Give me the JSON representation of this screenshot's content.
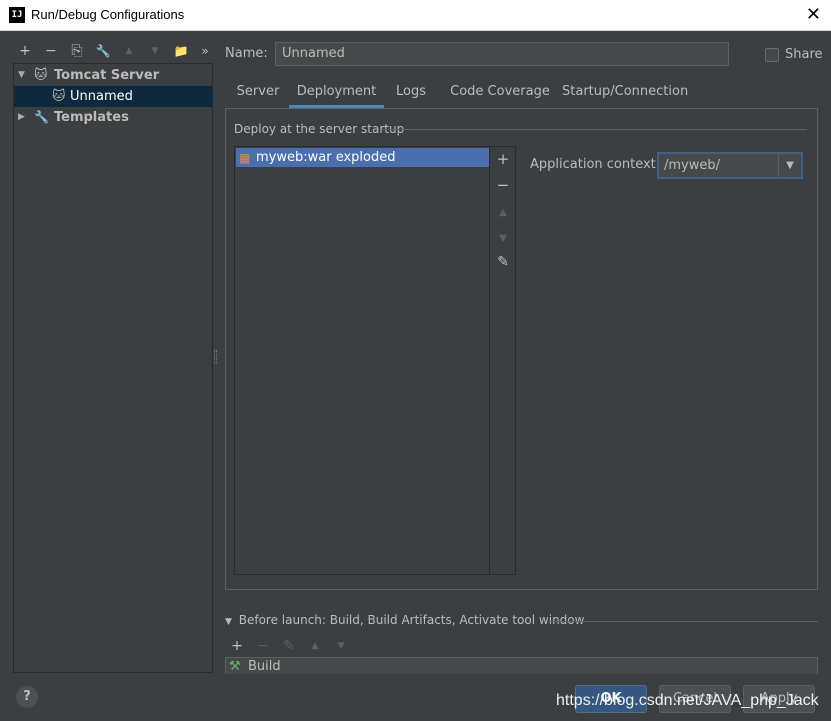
{
  "window": {
    "title": "Run/Debug Configurations",
    "app_icon_text": "IJ",
    "close_glyph": "✕"
  },
  "left_toolbar": {
    "add_glyph": "+",
    "remove_glyph": "−",
    "copy_glyph": "⎘",
    "edit_defaults_glyph": "🔧",
    "move_up_glyph": "▲",
    "move_down_glyph": "▼",
    "new_folder_glyph": "📁",
    "more_glyph": "»"
  },
  "tree": {
    "items": [
      {
        "label": "Tomcat Server",
        "icon": "tomcat-icon",
        "expand_glyph": "▼"
      },
      {
        "label": "Unnamed",
        "icon": "tomcat-icon"
      },
      {
        "label": "Templates",
        "icon": "wrench-icon",
        "expand_glyph": "▶"
      }
    ],
    "tomcat_glyph": "🐱",
    "wrench_glyph": "🔧"
  },
  "form": {
    "name_label": "Name:",
    "name_value": "Unnamed",
    "share_label": "Share"
  },
  "tabs": [
    {
      "label": "Server"
    },
    {
      "label": "Deployment"
    },
    {
      "label": "Logs"
    },
    {
      "label": "Code Coverage"
    },
    {
      "label": "Startup/Connection"
    }
  ],
  "deployment": {
    "section_title": "Deploy at the server startup",
    "artifacts": [
      {
        "label": "myweb:war exploded",
        "icon": "artifact-icon",
        "icon_glyph": "▦"
      }
    ],
    "tools": {
      "add_glyph": "+",
      "remove_glyph": "−",
      "up_glyph": "▲",
      "down_glyph": "▼",
      "edit_glyph": "✎"
    },
    "app_context_label": "Application context:",
    "app_context_value": "/myweb/",
    "dropdown_glyph": "▼"
  },
  "before_launch": {
    "title": "Before launch: Build, Build Artifacts, Activate tool window",
    "collapse_glyph": "▼",
    "tools": {
      "add_glyph": "+",
      "remove_glyph": "−",
      "edit_glyph": "✎",
      "up_glyph": "▲",
      "down_glyph": "▼"
    },
    "items": [
      {
        "label": "Build",
        "icon": "hammer-icon",
        "icon_glyph": "⚒"
      }
    ]
  },
  "footer": {
    "help_glyph": "?",
    "ok_label": "OK",
    "cancel_label": "Cancel",
    "apply_label": "Apply",
    "watermark": "https://blog.csdn.net/JAVA_php_Jack"
  },
  "colors": {
    "background": "#3c3f41",
    "selection": "#4b6eaf",
    "tree_selection": "#0d293e",
    "tab_underline": "#4a88c7",
    "primary_button": "#365880"
  }
}
